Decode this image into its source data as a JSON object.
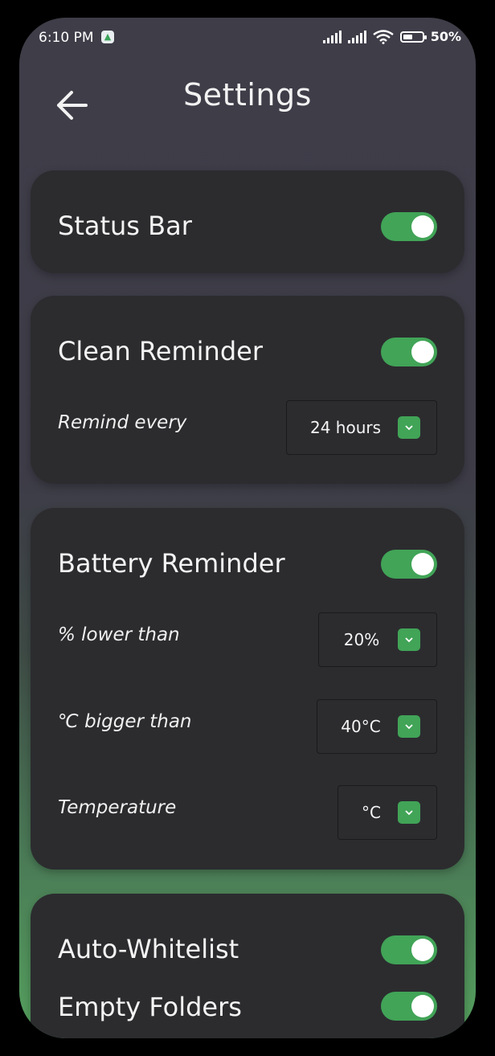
{
  "status_bar": {
    "time": "6:10 PM",
    "app_icon": "app-notification-icon",
    "battery_percent": "50%",
    "battery_level": 0.5
  },
  "header": {
    "title": "Settings",
    "back_icon": "arrow-left-icon"
  },
  "colors": {
    "accent": "#41a457",
    "card": "#2c2c2f",
    "background_top": "#3e3d48",
    "background_bottom": "#55a05e"
  },
  "status_bar_card": {
    "title": "Status Bar",
    "enabled": true
  },
  "clean_reminder": {
    "title": "Clean Reminder",
    "enabled": true,
    "remind_label": "Remind every",
    "remind_value": "24 hours"
  },
  "battery_reminder": {
    "title": "Battery Reminder",
    "enabled": true,
    "lower_label": "% lower than",
    "lower_value": "20%",
    "bigger_label": "℃ bigger than",
    "bigger_value": "40°C",
    "temp_label": "Temperature",
    "temp_value": "°C"
  },
  "cleaning": {
    "auto_whitelist_label": "Auto-Whitelist",
    "auto_whitelist_enabled": true,
    "empty_folders_label": "Empty Folders",
    "empty_folders_enabled": true
  }
}
